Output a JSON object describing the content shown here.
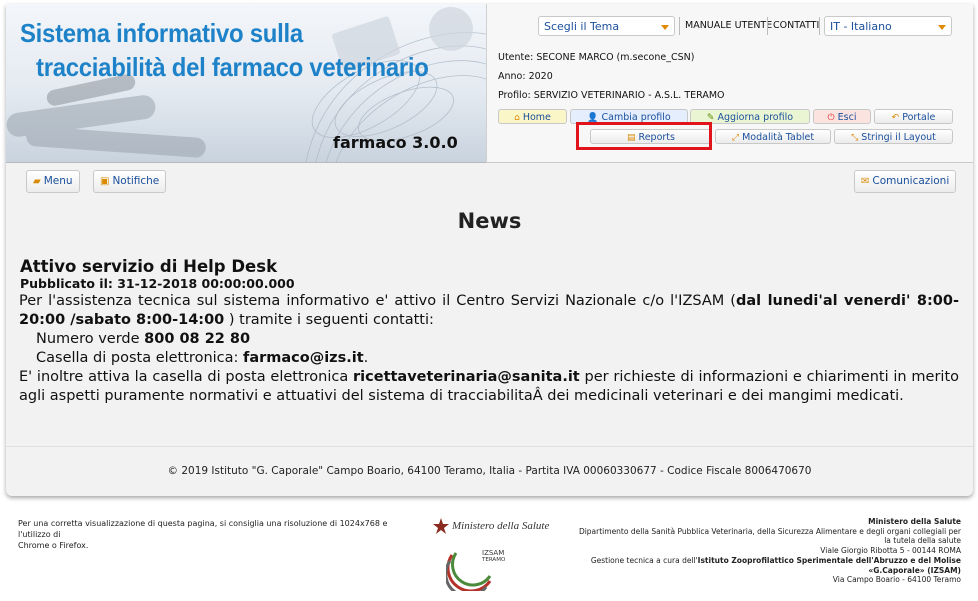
{
  "header": {
    "title_line1": "Sistema informativo sulla",
    "title_line2": "tracciabilità del farmaco veterinario",
    "version": "farmaco 3.0.0"
  },
  "topbar": {
    "theme_select": "Scegli il Tema",
    "manuale_label": "MANUALE UTENTE",
    "contatti_label": "CONTATTI",
    "language_select": "IT - Italiano"
  },
  "user_info": {
    "utente": "Utente: SECONE MARCO (m.secone_CSN)",
    "anno": "Anno: 2020",
    "profilo": "Profilo: SERVIZIO VETERINARIO - A.S.L. TERAMO"
  },
  "actions": {
    "home": "Home",
    "cambia_profilo": "Cambia profilo",
    "aggiorna_profilo": "Aggiorna profilo",
    "esci": "Esci",
    "portale": "Portale",
    "reports": "Reports",
    "modalita_tablet": "Modalità Tablet",
    "stringi_layout": "Stringi il Layout"
  },
  "toolbar": {
    "menu": "Menu",
    "notifiche": "Notifiche",
    "comunicazioni": "Comunicazioni"
  },
  "news": {
    "heading": "News",
    "article_title": "Attivo servizio di Help Desk",
    "published": "Pubblicato il: 31-12-2018 00:00:00.000",
    "p1_a": "Per l'assistenza tecnica sul sistema informativo e' attivo il Centro Servizi Nazionale c/o l'IZSAM (",
    "p1_bold": "dal lunedi'al venerdi' 8:00-20:00 /sabato 8:00-14:00",
    "p1_b": " ) tramite i seguenti contatti:",
    "numero_label": "Numero verde ",
    "numero_value": "800 08 22 80",
    "casella_label": "Casella di posta elettronica: ",
    "casella_value": "farmaco@izs.it",
    "casella_end": ".",
    "p2_a": "E' inoltre attiva la casella di posta elettronica ",
    "p2_bold": "ricettaveterinaria@sanita.it",
    "p2_b": " per richieste di informazioni e chiarimenti in merito agli aspetti puramente normativi e attuativi del sistema di tracciabilitaÂ  dei medicinali veterinari e dei mangimi medicati."
  },
  "footer": {
    "copyright": "© 2019 Istituto \"G. Caporale\" Campo Boario, 64100 Teramo, Italia - Partita IVA 00060330677 - Codice Fiscale 8006470670"
  },
  "bottom": {
    "advice_line1": "Per una corretta visualizzazione di questa pagina, si consiglia una risoluzione di 1024x768 e l'utilizzo di",
    "advice_line2": "Chrome o Firefox.",
    "ministero_logo_text": "Ministero della Salute",
    "izsam_logo_text": "IZSAM",
    "izsam_logo_sub": "TERAMO",
    "r1": "Ministero della Salute",
    "r2": "Dipartimento della Sanità Pubblica Veterinaria, della Sicurezza Alimentare e degli organi collegiali per",
    "r3": "la tutela della salute",
    "r4": "Viale Giorgio Ribotta 5 - 00144 ROMA",
    "r5_a": "Gestione tecnica a cura dell'",
    "r5_bold": "Istituto Zooprofilattico Sperimentale dell'Abruzzo e del Molise",
    "r6": "«G.Caporale» (IZSAM)",
    "r7": "Via Campo Boario - 64100 Teramo"
  },
  "colors": {
    "title_blue": "#1e82c9",
    "link_blue": "#1a4f9c",
    "highlight_red": "#e0141a",
    "accent_orange": "#e08a00"
  }
}
